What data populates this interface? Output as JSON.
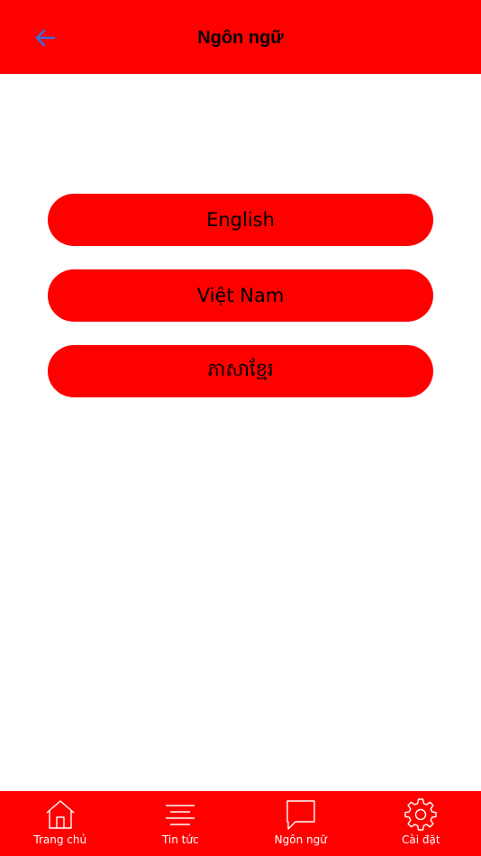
{
  "header": {
    "title": "Ngôn ngữ",
    "back_icon": "arrow-left-icon"
  },
  "languages": [
    {
      "label": "English"
    },
    {
      "label": "Việt Nam"
    },
    {
      "label": "ភាសាខ្មែរ"
    }
  ],
  "tabbar": {
    "items": [
      {
        "label": "Trang chủ",
        "icon": "home-icon"
      },
      {
        "label": "Tin tức",
        "icon": "menu-lines-icon"
      },
      {
        "label": "Ngôn ngữ",
        "icon": "chat-bubble-icon"
      },
      {
        "label": "Cài đặt",
        "icon": "gear-icon"
      }
    ]
  },
  "colors": {
    "primary": "#ff0000",
    "back_icon": "#3b6fd8",
    "background": "#ffffff",
    "tab_text": "#ffffff"
  }
}
